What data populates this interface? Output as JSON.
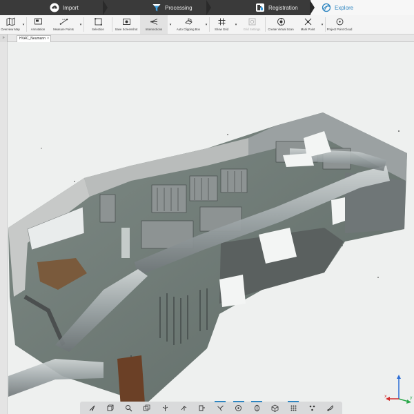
{
  "stages": [
    {
      "label": "Import",
      "icon": "import-cloud-icon",
      "active": false
    },
    {
      "label": "Processing",
      "icon": "funnel-icon",
      "active": false
    },
    {
      "label": "Registration",
      "icon": "registration-puzzle-icon",
      "active": false
    },
    {
      "label": "Explore",
      "icon": "explore-globe-icon",
      "active": true
    }
  ],
  "ribbon": {
    "overview_map": "Overview Map",
    "annotation": "Annotation",
    "measure_points": "Measure Points",
    "selection": "Selection",
    "save_screenshot": "Save Screenshot",
    "intersections": "Intersections",
    "auto_clipping_box": "Auto Clipping Box",
    "show_grid": "Show Grid",
    "grid_settings": "Grid Settings",
    "create_virtual_scan": "Create Virtual Scan",
    "mark_point": "Mark Point",
    "project_point_cloud": "Project Point Cloud"
  },
  "document": {
    "tab_label": "HVAC_Neumann",
    "close_glyph": "×",
    "panel_toggle": "»"
  },
  "viewbar": {
    "buttons": [
      "select-arrow-icon",
      "view-cube-icon",
      "zoom-icon",
      "box-view-icon",
      "fly-icon",
      "walk-icon",
      "clip-icon",
      "path-icon",
      "orbit-icon",
      "section-icon",
      "cube-icon",
      "grid-dots-icon",
      "color-dots-icon",
      "style-icon"
    ],
    "active": [
      7,
      8,
      9,
      11
    ]
  },
  "triad": {
    "x_label": "x",
    "y_label": "y",
    "colors": {
      "x": "#d22c2c",
      "y": "#2aa84a",
      "z": "#2f6fd6"
    }
  },
  "colors": {
    "accent": "#2e86c1",
    "stagebar": "#3a3a3a",
    "ribbon": "#f4f4f4"
  }
}
